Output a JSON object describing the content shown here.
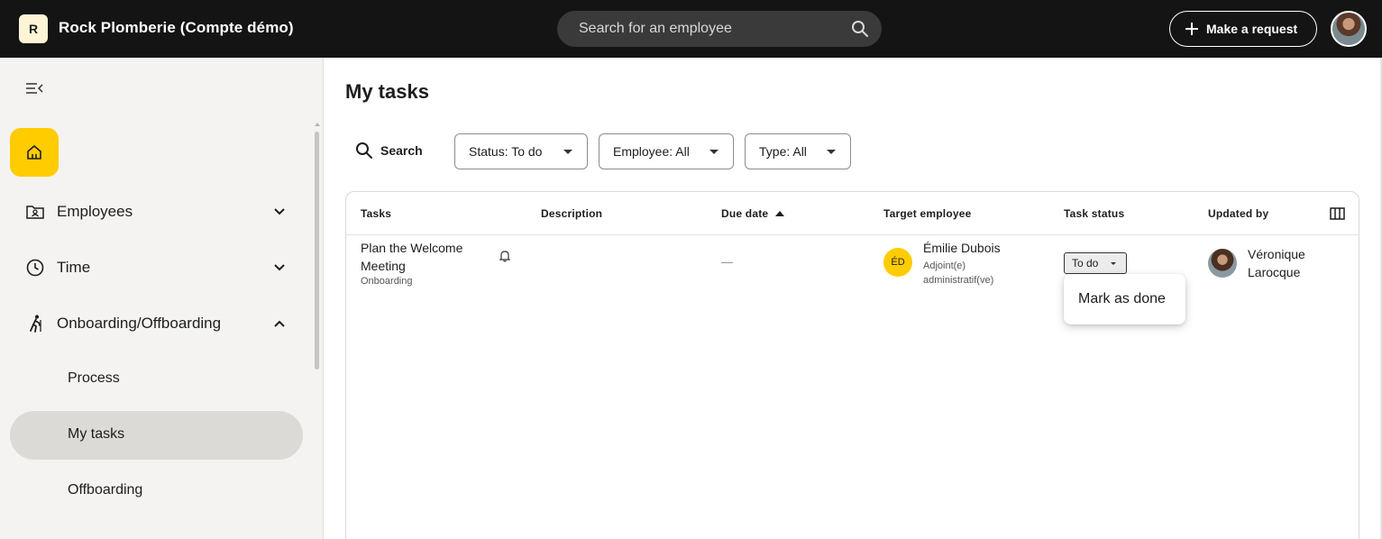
{
  "topbar": {
    "logo_letter": "R",
    "company": "Rock Plomberie (Compte démo)",
    "search_placeholder": "Search for an employee",
    "request_button": "Make a request"
  },
  "sidebar": {
    "items": [
      {
        "label": "Employees"
      },
      {
        "label": "Time"
      },
      {
        "label": "Onboarding/Offboarding"
      }
    ],
    "sub_items": [
      "Process",
      "My tasks",
      "Offboarding"
    ]
  },
  "main": {
    "title": "My tasks",
    "search_label": "Search",
    "filters": [
      "Status: To do",
      "Employee: All",
      "Type: All"
    ],
    "columns": [
      "Tasks",
      "Description",
      "Due date",
      "Target employee",
      "Task status",
      "Updated by"
    ],
    "rows": [
      {
        "task": "Plan the Welcome Meeting",
        "type": "Onboarding",
        "due": "—",
        "employee_initials": "ÉD",
        "employee_name": "Émilie Dubois",
        "employee_role": "Adjoint(e) administratif(ve)",
        "status": "To do",
        "updated_by": "Véronique Larocque"
      }
    ],
    "status_menu": [
      "Mark as done"
    ]
  },
  "colors": {
    "topbar": "#141414",
    "accent": "#ffcc00",
    "sidebar": "#f4f3f1"
  }
}
